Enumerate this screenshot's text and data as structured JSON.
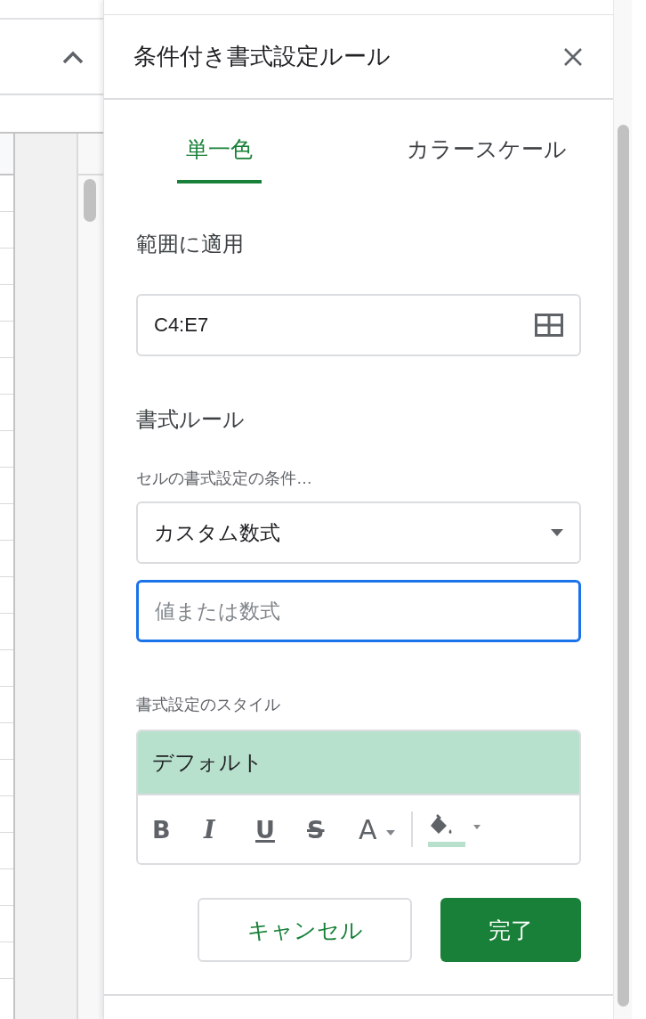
{
  "panel": {
    "title": "条件付き書式設定ルール",
    "tabs": [
      {
        "label": "単一色",
        "selected": true
      },
      {
        "label": "カラースケール",
        "selected": false
      }
    ],
    "range": {
      "label": "範囲に適用",
      "value": "C4:E7"
    },
    "rules": {
      "heading": "書式ルール",
      "condition_label": "セルの書式設定の条件…",
      "condition": "カスタム数式",
      "formula": {
        "placeholder": "値または数式",
        "focused": true
      }
    },
    "style": {
      "label": "書式設定のスタイル",
      "preview": "デフォルト",
      "tools": [
        {
          "kind": "bold",
          "label": "B"
        },
        {
          "kind": "italic",
          "label": "I"
        },
        {
          "kind": "underline",
          "label": "U"
        },
        {
          "kind": "strike",
          "label": "S"
        },
        {
          "kind": "text-color",
          "label": "A"
        },
        {
          "kind": "fill-color"
        }
      ]
    },
    "buttons": [
      {
        "kind": "cancel",
        "label": "キャンセル"
      },
      {
        "kind": "done",
        "label": "完了"
      }
    ]
  }
}
